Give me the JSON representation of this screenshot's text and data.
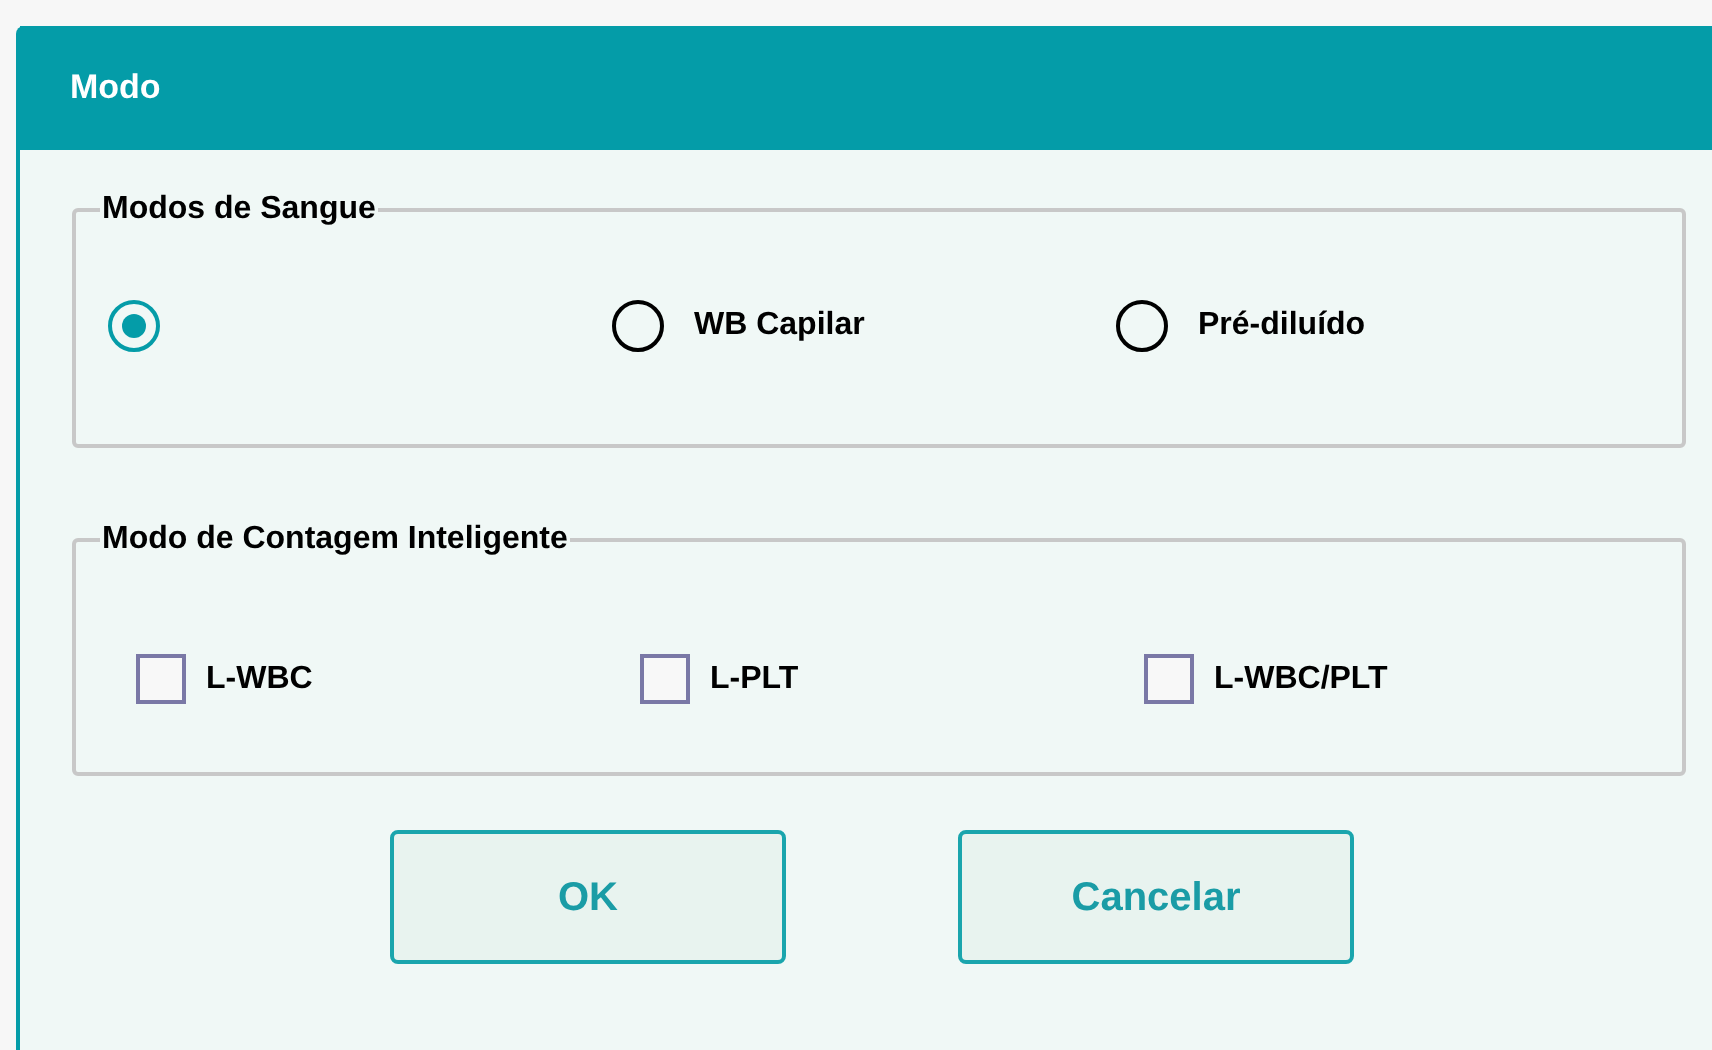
{
  "dialog": {
    "title": "Modo"
  },
  "blood_modes": {
    "title": "Modos de Sangue",
    "options": [
      {
        "selected": true
      },
      {
        "label": "WB Capilar",
        "selected": false
      },
      {
        "label": "Pré-diluído",
        "selected": false
      }
    ]
  },
  "smart_count": {
    "title": "Modo de Contagem Inteligente",
    "options": [
      {
        "label": "L-WBC",
        "checked": false
      },
      {
        "label": "L-PLT",
        "checked": false
      },
      {
        "label": "L-WBC/PLT",
        "checked": false
      }
    ]
  },
  "buttons": [
    "OK",
    "Cancelar"
  ]
}
